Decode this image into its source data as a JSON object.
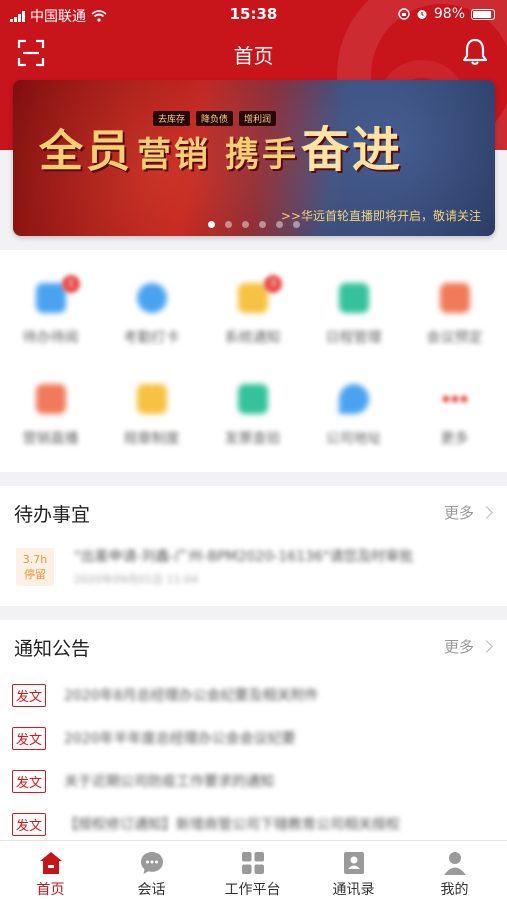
{
  "status_bar": {
    "carrier": "中国联通",
    "time": "15:38",
    "battery": "98%"
  },
  "header": {
    "title": "首页"
  },
  "banner": {
    "slogan": [
      "全员",
      "营销",
      "携手",
      "奋进"
    ],
    "tags": [
      "去库存",
      "降负债",
      "增利润"
    ],
    "note": ">>华远首轮直播即将开启，敬请关注",
    "dots": 6,
    "active_dot": 0
  },
  "quick_menu": [
    {
      "label": "待办待阅",
      "color": "#4aa3f0",
      "badge": "1"
    },
    {
      "label": "考勤打卡",
      "color": "#4aa3f0",
      "badge": ""
    },
    {
      "label": "系统通知",
      "color": "#f5c243",
      "badge": "3"
    },
    {
      "label": "日程管理",
      "color": "#34c29a",
      "badge": ""
    },
    {
      "label": "会议预定",
      "color": "#f07a5a",
      "badge": ""
    },
    {
      "label": "营销直播",
      "color": "#f07a5a",
      "badge": ""
    },
    {
      "label": "规章制度",
      "color": "#f5c243",
      "badge": ""
    },
    {
      "label": "发票查验",
      "color": "#34c29a",
      "badge": ""
    },
    {
      "label": "公司地址",
      "color": "#4aa3f0",
      "badge": ""
    },
    {
      "label": "更多",
      "color": "#e94b4b",
      "badge": ""
    }
  ],
  "todo": {
    "title": "待办事宜",
    "more": "更多",
    "items": [
      {
        "badge_top": "3.7h",
        "badge_bottom": "停留",
        "title": "\"出差申请-刘鑫-广州-BPM2020-16136\"请您及时审批",
        "time": "2020年09月01日 11:04"
      }
    ]
  },
  "notice": {
    "title": "通知公告",
    "more": "更多",
    "items": [
      {
        "tag": "发文",
        "text": "2020年8月总经理办公会纪要及相关附件"
      },
      {
        "tag": "发文",
        "text": "2020年半年度总经理办公会会议纪要"
      },
      {
        "tag": "发文",
        "text": "关于近期公司防疫工作要求的通知"
      },
      {
        "tag": "发文",
        "text": "【授权修订通知】新增商管公司下辖教育公司相关授权"
      }
    ]
  },
  "tabbar": [
    {
      "label": "首页",
      "icon": "home-icon",
      "active": true
    },
    {
      "label": "会话",
      "icon": "chat-icon",
      "active": false
    },
    {
      "label": "工作平台",
      "icon": "apps-grid-icon",
      "active": false
    },
    {
      "label": "通讯录",
      "icon": "contacts-icon",
      "active": false
    },
    {
      "label": "我的",
      "icon": "user-icon",
      "active": false
    }
  ],
  "colors": {
    "brand": "#c8141b",
    "tag_red": "#d8161c",
    "todo_orange": "#e8953e"
  }
}
